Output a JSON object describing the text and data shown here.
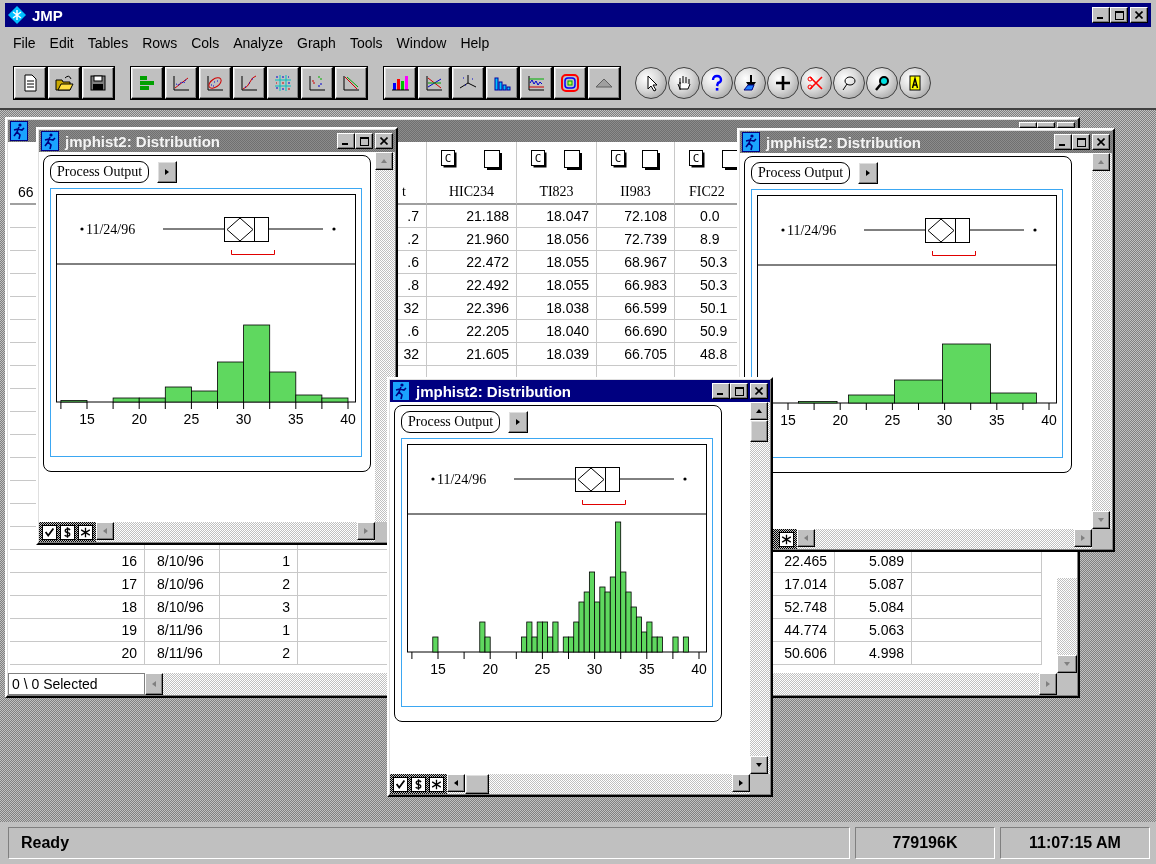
{
  "app": {
    "title": "JMP"
  },
  "menu": [
    "File",
    "Edit",
    "Tables",
    "Rows",
    "Cols",
    "Analyze",
    "Graph",
    "Tools",
    "Window",
    "Help"
  ],
  "data_table": {
    "row_count": "66",
    "columns": [
      {
        "name": "t"
      },
      {
        "name": "HIC234",
        "type": "C"
      },
      {
        "name": "TI823",
        "type": "C"
      },
      {
        "name": "II983",
        "type": "C"
      },
      {
        "name": "FIC22",
        "type": "C"
      }
    ],
    "upper_rows": [
      [
        ".7",
        "21.188",
        "18.047",
        "72.108",
        "0.0"
      ],
      [
        ".2",
        "21.960",
        "18.056",
        "72.739",
        "8.9"
      ],
      [
        ".6",
        "22.472",
        "18.055",
        "68.967",
        "50.3"
      ],
      [
        ".8",
        "22.492",
        "18.055",
        "66.983",
        "50.3"
      ],
      [
        "32",
        "22.396",
        "18.038",
        "66.599",
        "50.1"
      ],
      [
        ".6",
        "22.205",
        "18.040",
        "66.690",
        "50.9"
      ],
      [
        "32",
        "21.605",
        "18.039",
        "66.705",
        "48.8"
      ]
    ],
    "lower_rows": [
      {
        "row": "16",
        "date": "8/10/96",
        "column_3": "1",
        "column_9": "22.465",
        "column_10": "5.089"
      },
      {
        "row": "17",
        "date": "8/10/96",
        "column_3": "2",
        "column_9": "17.014",
        "column_10": "5.087"
      },
      {
        "row": "18",
        "date": "8/10/96",
        "column_3": "3",
        "column_9": "52.748",
        "column_10": "5.084"
      },
      {
        "row": "19",
        "date": "8/11/96",
        "column_3": "1",
        "column_9": "44.774",
        "column_10": "5.063"
      },
      {
        "row": "20",
        "date": "8/11/96",
        "column_3": "2",
        "column_9": "50.606",
        "column_10": "4.998"
      }
    ],
    "footer": "0 \\ 0 Selected"
  },
  "windows": [
    {
      "title": "jmphist2: Distribution",
      "active": false,
      "outline": "Process Output",
      "outlier_label": "11/24/96",
      "ticks": [
        "15",
        "20",
        "25",
        "30",
        "35",
        "40"
      ]
    },
    {
      "title": "jmphist2: Distribution",
      "active": false,
      "outline": "Process Output",
      "outlier_label": "11/24/96",
      "ticks": [
        "15",
        "20",
        "25",
        "30",
        "35",
        "40"
      ]
    },
    {
      "title": "jmphist2: Distribution",
      "active": true,
      "outline": "Process Output",
      "outlier_label": "11/24/96",
      "ticks": [
        "15",
        "20",
        "25",
        "30",
        "35",
        "40"
      ]
    }
  ],
  "status_bar": {
    "message": "Ready",
    "memory": "779196K",
    "time": "11:07:15 AM"
  }
}
